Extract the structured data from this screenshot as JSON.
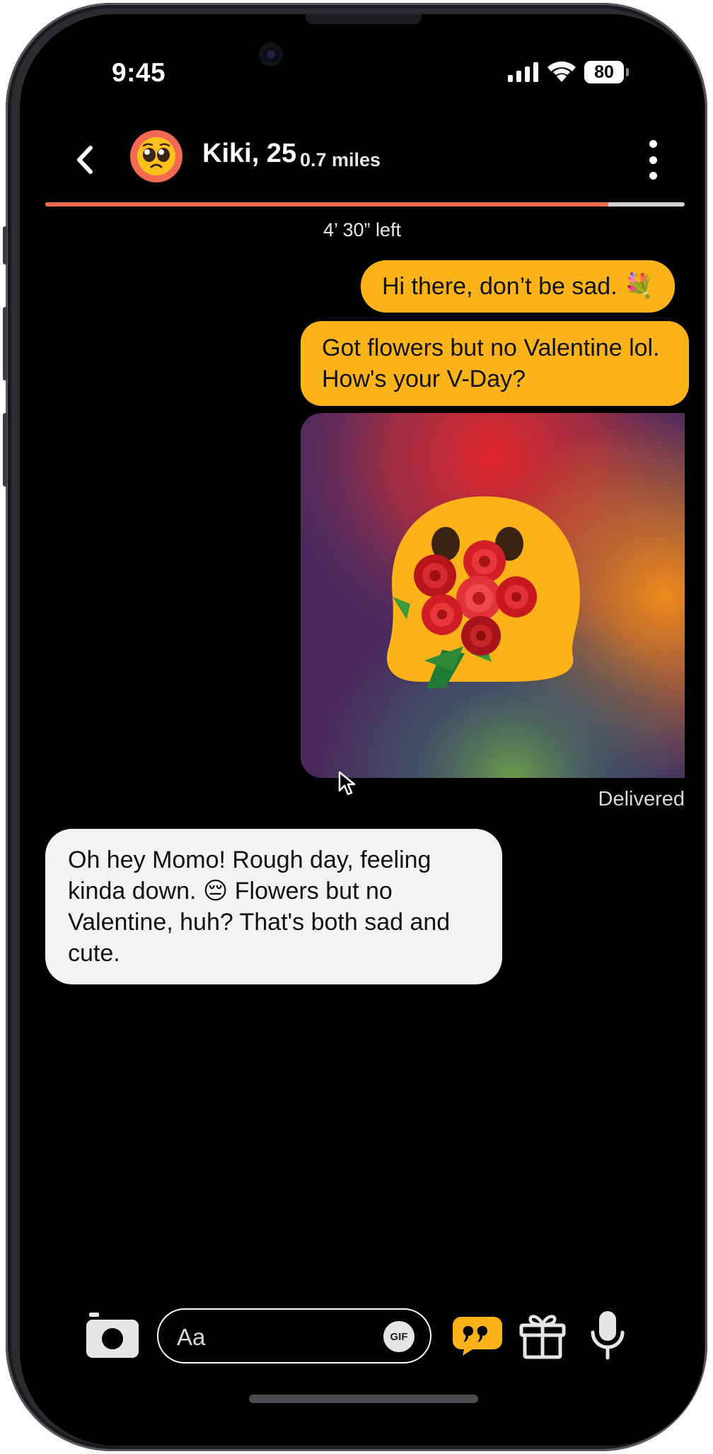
{
  "status_bar": {
    "time": "9:45",
    "battery": "80",
    "icons": [
      "cellular-signal-icon",
      "wifi-icon",
      "battery-icon"
    ]
  },
  "header": {
    "name": "Kiki, 25",
    "distance": "0.7 miles",
    "avatar_emoji": "🥺",
    "progress": 0.88,
    "timer": "4’ 30” left",
    "accent_color": "#f26a4f"
  },
  "messages": [
    {
      "direction": "outgoing",
      "text": "Hi there, don’t be sad. 💐"
    },
    {
      "direction": "outgoing",
      "text": "Got flowers but no Valentine lol. How's your V-Day?"
    },
    {
      "direction": "outgoing",
      "type": "sticker",
      "description_icon": "blob-with-roses-sticker"
    },
    {
      "direction": "incoming",
      "text": "Oh hey Momo! Rough day, feeling kinda down. 😔 Flowers but no Valentine, huh? That's both sad and cute."
    }
  ],
  "delivery_status": "Delivered",
  "composer": {
    "placeholder": "Aa",
    "gif_label": "GIF",
    "icons": [
      "camera-icon",
      "quote-icon",
      "gift-icon",
      "microphone-icon"
    ]
  },
  "colors": {
    "outgoing_bubble": "#fbb319",
    "incoming_bubble": "#f3f3f3",
    "background": "#000000"
  }
}
